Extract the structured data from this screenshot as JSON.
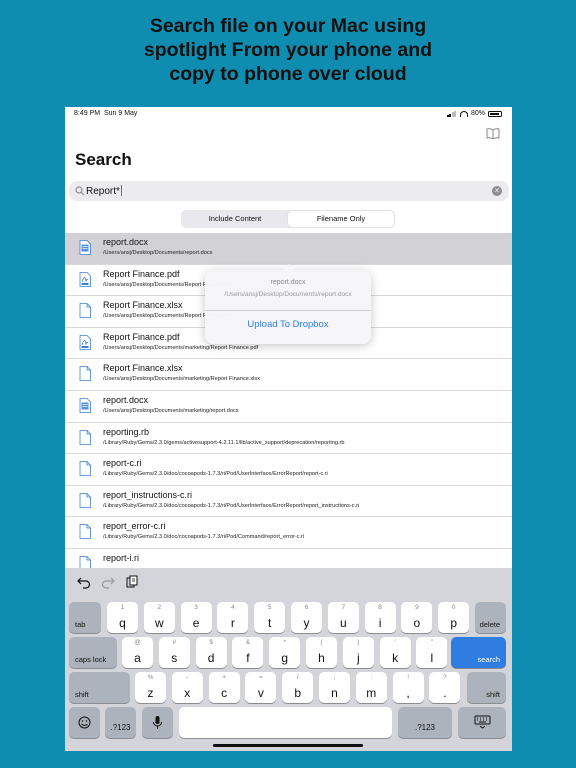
{
  "headline": [
    "Search file on your Mac using",
    "spotlight From your phone and",
    "copy to phone over cloud"
  ],
  "status": {
    "time": "8:49 PM",
    "date": "Sun 9 May",
    "battery": "80%"
  },
  "page_title": "Search",
  "search": {
    "query": "Report*"
  },
  "segments": [
    "Include Content",
    "Filename Only"
  ],
  "selected_segment": "Filename Only",
  "results": [
    {
      "name": "report.docx",
      "path": "/Users/ansj/Desktop/Documents/report.docx",
      "type": "docx",
      "selected": true
    },
    {
      "name": "Report Finance.pdf",
      "path": "/Users/ansj/Desktop/Documents/Report Finance.pdf",
      "type": "pdf"
    },
    {
      "name": "Report Finance.xlsx",
      "path": "/Users/ansj/Desktop/Documents/Report Finance.xlsx",
      "type": "file"
    },
    {
      "name": "Report Finance.pdf",
      "path": "/Users/ansj/Desktop/Documents/marketing/Report Finance.pdf",
      "type": "pdf"
    },
    {
      "name": "Report Finance.xlsx",
      "path": "/Users/ansj/Desktop/Documents/marketing/Report Finance.xlsx",
      "type": "file"
    },
    {
      "name": "report.docx",
      "path": "/Users/ansj/Desktop/Documents/marketing/report.docx",
      "type": "docx"
    },
    {
      "name": "reporting.rb",
      "path": "/Library/Ruby/Gems/2.3.0/gems/activesupport-4.2.11.1/lib/active_support/deprecation/reporting.rb",
      "type": "file"
    },
    {
      "name": "report-c.ri",
      "path": "/Library/Ruby/Gems/2.3.0/doc/cocoapods-1.7.3/ri/Pod/UserInterface/ErrorReport/report-c.ri",
      "type": "file"
    },
    {
      "name": "report_instructions-c.ri",
      "path": "/Library/Ruby/Gems/2.3.0/doc/cocoapods-1.7.3/ri/Pod/UserInterface/ErrorReport/report_instructions-c.ri",
      "type": "file"
    },
    {
      "name": "report_error-c.ri",
      "path": "/Library/Ruby/Gems/2.3.0/doc/cocoapods-1.7.3/ri/Pod/Command/report_error-c.ri",
      "type": "file"
    },
    {
      "name": "report-i.ri",
      "path": "",
      "type": "file"
    }
  ],
  "popup": {
    "title": "report.docx",
    "path": "/Users/ansj/Desktop/Documents/report.docx",
    "action": "Upload To Dropbox"
  },
  "keyboard": {
    "row1": [
      [
        "1",
        "q"
      ],
      [
        "2",
        "w"
      ],
      [
        "3",
        "e"
      ],
      [
        "4",
        "r"
      ],
      [
        "5",
        "t"
      ],
      [
        "6",
        "y"
      ],
      [
        "7",
        "u"
      ],
      [
        "8",
        "i"
      ],
      [
        "9",
        "o"
      ],
      [
        "0",
        "p"
      ]
    ],
    "row2": [
      [
        "@",
        "a"
      ],
      [
        "#",
        "s"
      ],
      [
        "$",
        "d"
      ],
      [
        "&",
        "f"
      ],
      [
        "*",
        "g"
      ],
      [
        "(",
        "h"
      ],
      [
        ")",
        "j"
      ],
      [
        "'",
        "k"
      ],
      [
        "\"",
        "l"
      ]
    ],
    "row3": [
      [
        "%",
        "z"
      ],
      [
        "-",
        "x"
      ],
      [
        "+",
        "c"
      ],
      [
        "=",
        "v"
      ],
      [
        "/",
        "b"
      ],
      [
        ";",
        "n"
      ],
      [
        ":",
        "m"
      ],
      [
        "!",
        ","
      ],
      [
        "?",
        "."
      ]
    ],
    "tab": "tab",
    "delete": "delete",
    "caps": "caps lock",
    "search": "search",
    "shift": "shift",
    "numbers": ".?123"
  }
}
